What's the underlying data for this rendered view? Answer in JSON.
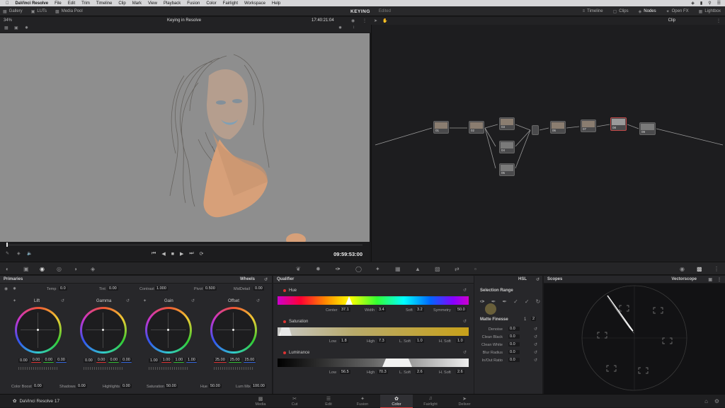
{
  "menubar": {
    "app": "DaVinci Resolve",
    "items": [
      "File",
      "Edit",
      "Trim",
      "Timeline",
      "Clip",
      "Mark",
      "View",
      "Playback",
      "Fusion",
      "Color",
      "Fairlight",
      "Workspace",
      "Help"
    ]
  },
  "header": {
    "left": [
      "Gallery",
      "LUTs",
      "Media Pool"
    ],
    "project": "KEYING",
    "status": "Edited",
    "right": [
      "Timeline",
      "Clips",
      "Nodes",
      "Open FX",
      "Lightbox"
    ]
  },
  "viewer": {
    "zoom": "34%",
    "clip_name": "Keying in Resolve",
    "timecode": "17:40:21:04",
    "playhead_timecode": "09:59:53:00"
  },
  "nodes": {
    "mode": "Clip",
    "labels": [
      "01",
      "02",
      "03",
      "04",
      "05",
      "06",
      "07",
      "08",
      "09"
    ]
  },
  "primaries": {
    "title": "Primaries",
    "mode": "Wheels",
    "temp_label": "Temp",
    "temp": "0.0",
    "tint_label": "Tint",
    "tint": "0.00",
    "contrast_label": "Contrast",
    "contrast": "1.000",
    "pivot_label": "Pivot",
    "pivot": "0.500",
    "middetail_label": "MidDetail",
    "middetail": "0.00",
    "wheels": [
      {
        "name": "Lift",
        "values": [
          "0.00",
          "0.00",
          "0.00",
          "0.00"
        ]
      },
      {
        "name": "Gamma",
        "values": [
          "0.00",
          "0.00",
          "0.00",
          "0.00"
        ]
      },
      {
        "name": "Gain",
        "values": [
          "1.00",
          "1.00",
          "1.00",
          "1.00"
        ]
      },
      {
        "name": "Offset",
        "values": [
          "25.00",
          "25.00",
          "25.00"
        ]
      }
    ],
    "colorboost_label": "Color Boost",
    "colorboost": "0.00",
    "shadows_label": "Shadows",
    "shadows": "0.00",
    "highlights_label": "Highlights",
    "highlights": "0.00",
    "saturation_label": "Saturation",
    "saturation": "50.00",
    "hue_label": "Hue",
    "hue": "50.00",
    "lummix_label": "Lum Mix",
    "lummix": "100.00"
  },
  "qualifier": {
    "title": "Qualifier",
    "mode": "HSL",
    "hue": {
      "label": "Hue",
      "center_label": "Center",
      "center": "37.1",
      "width_label": "Width",
      "width": "3.4",
      "soft_label": "Soft",
      "soft": "3.2",
      "symmetry_label": "Symmetry",
      "symmetry": "50.0"
    },
    "saturation": {
      "label": "Saturation",
      "low_label": "Low",
      "low": "1.8",
      "high_label": "High",
      "high": "7.3",
      "lsoft_label": "L. Soft",
      "lsoft": "1.0",
      "hsoft_label": "H. Soft",
      "hsoft": "1.0"
    },
    "luminance": {
      "label": "Luminance",
      "low_label": "Low",
      "low": "56.5",
      "high_label": "High",
      "high": "70.3",
      "lsoft_label": "L. Soft",
      "lsoft": "2.6",
      "hsoft_label": "H. Soft",
      "hsoft": "2.6"
    }
  },
  "selection": {
    "title": "Selection Range",
    "matte_title": "Matte Finesse",
    "page1": "1",
    "page2": "2",
    "rows": [
      {
        "label": "Denoise",
        "value": "0.0"
      },
      {
        "label": "Clean Black",
        "value": "0.0"
      },
      {
        "label": "Clean White",
        "value": "0.0"
      },
      {
        "label": "Blur Radius",
        "value": "0.0"
      },
      {
        "label": "In/Out Ratio",
        "value": "0.0"
      }
    ]
  },
  "scopes": {
    "title": "Scopes",
    "mode": "Vectorscope"
  },
  "pages": {
    "brand": "DaVinci Resolve 17",
    "tabs": [
      "Media",
      "Cut",
      "Edit",
      "Fusion",
      "Color",
      "Fairlight",
      "Deliver"
    ],
    "active": "Color"
  }
}
